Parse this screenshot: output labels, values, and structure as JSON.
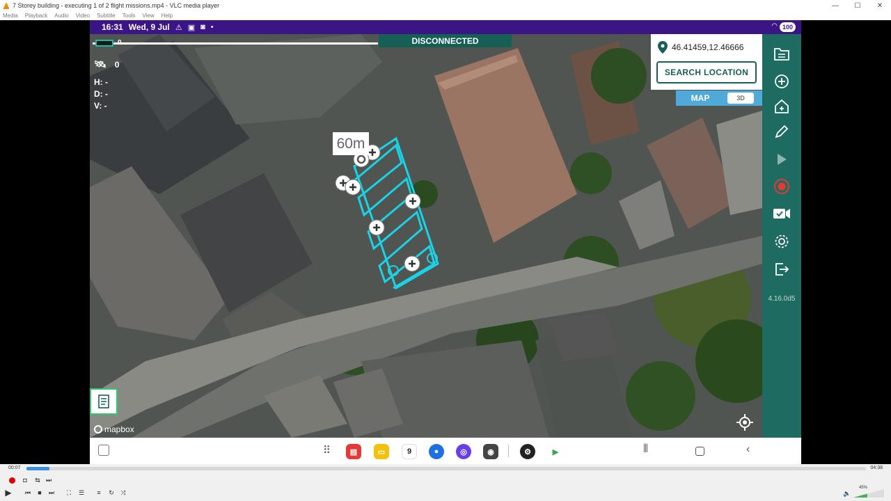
{
  "window": {
    "title": "7 Storey building - executing 1 of 2 flight missions.mp4 - VLC media player",
    "controls": [
      "—",
      "☐",
      "✕"
    ]
  },
  "menu": [
    "Media",
    "Playback",
    "Audio",
    "Video",
    "Subtitle",
    "Tools",
    "View",
    "Help"
  ],
  "statusbar": {
    "time": "16:31",
    "date": "Wed, 9 Jul",
    "battery": "100"
  },
  "flight": {
    "progress_value": "0",
    "connection": "DISCONNECTED",
    "satellites": "0",
    "height": "H: -",
    "distance": "D: -",
    "velocity": "V: -",
    "altitude_label": "60m"
  },
  "location": {
    "coordinates": "46.41459,12.46666",
    "search_label": "SEARCH LOCATION",
    "map_label": "MAP",
    "view_3d_label": "3D"
  },
  "map": {
    "attribution": "mapbox",
    "mission_color": "#19d3e6"
  },
  "sidebar": {
    "icons": [
      "files-icon",
      "add-icon",
      "home-icon",
      "edit-icon",
      "play-icon",
      "record-icon",
      "camera-icon",
      "settings-icon",
      "exit-icon"
    ],
    "version": "4.16.0d5"
  },
  "vlc": {
    "elapsed": "00:07",
    "total": "04:38",
    "position": 0.027,
    "volume": "45%"
  }
}
